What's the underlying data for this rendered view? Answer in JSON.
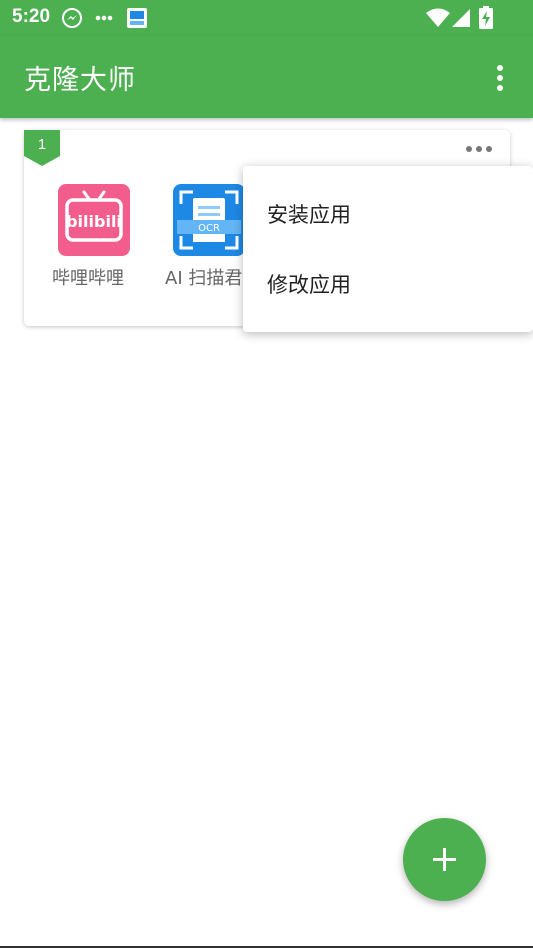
{
  "status_bar": {
    "time": "5:20",
    "icons": [
      "messenger-icon",
      "more-dots-icon",
      "image-notification-icon",
      "wifi-icon",
      "signal-icon",
      "battery-charging-icon"
    ]
  },
  "app_bar": {
    "title": "克隆大师",
    "overflow_icon": "more-vert-icon"
  },
  "card": {
    "badge_number": "1",
    "more_icon": "more-horiz-icon",
    "apps": [
      {
        "label": "哔哩哔哩",
        "icon": "bilibili-icon",
        "icon_color": "#f25d8e"
      },
      {
        "label": "AI 扫描君",
        "icon": "ocr-scanner-icon",
        "icon_color": "#1e88e5"
      }
    ]
  },
  "popup_menu": {
    "items": [
      {
        "label": "安装应用"
      },
      {
        "label": "修改应用"
      }
    ]
  },
  "fab": {
    "icon": "plus-icon"
  },
  "colors": {
    "primary": "#4caf50",
    "bilibili": "#f25d8e",
    "ocr_blue": "#1e88e5"
  }
}
